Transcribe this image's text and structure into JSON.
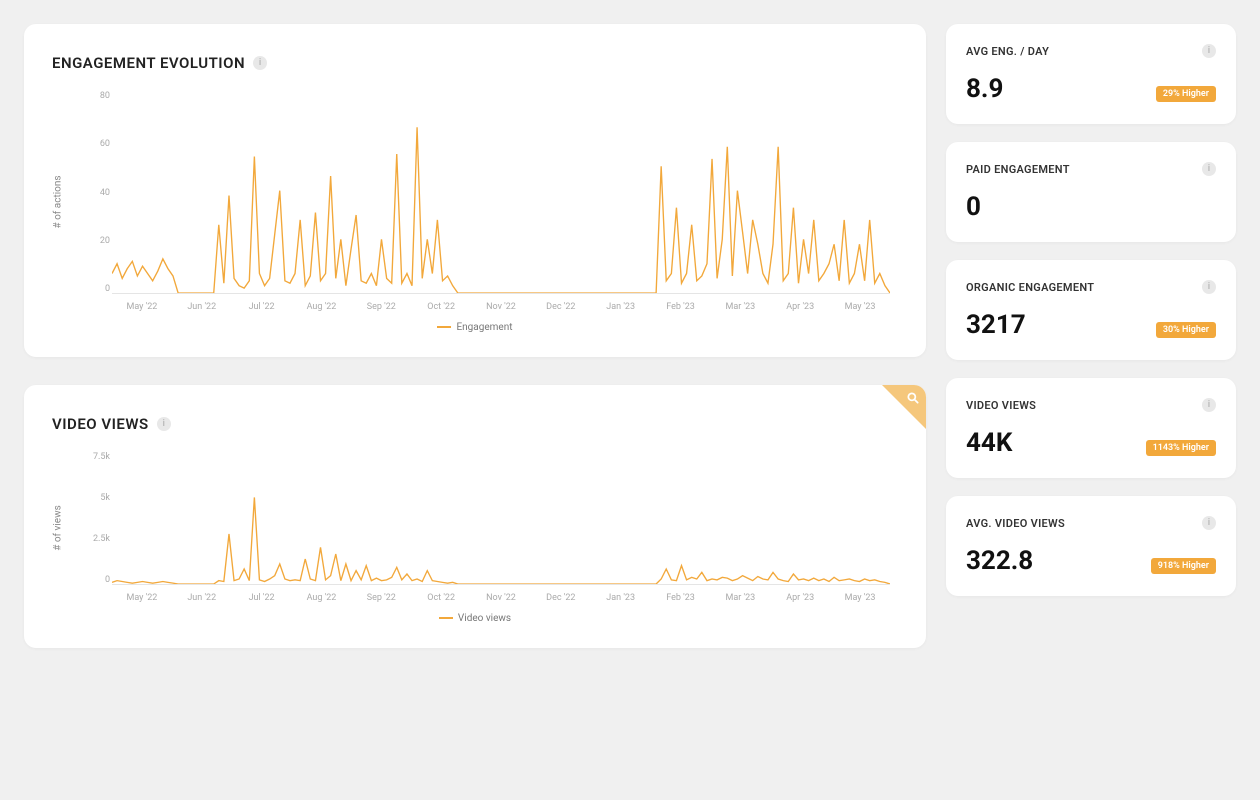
{
  "colors": {
    "accent": "#f2a83b"
  },
  "charts": {
    "engagement": {
      "title": "ENGAGEMENT EVOLUTION",
      "y_label": "# of actions",
      "legend": "Engagement"
    },
    "video": {
      "title": "VIDEO VIEWS",
      "y_label": "# of views",
      "legend": "Video views"
    },
    "x_ticks": [
      "May '22",
      "Jun '22",
      "Jul '22",
      "Aug '22",
      "Sep '22",
      "Oct '22",
      "Nov '22",
      "Dec '22",
      "Jan '23",
      "Feb '23",
      "Mar '23",
      "Apr '23",
      "May '23"
    ],
    "engagement_y_ticks": [
      "80",
      "60",
      "40",
      "20",
      "0"
    ],
    "video_y_ticks": [
      "7.5k",
      "5k",
      "2.5k",
      "0"
    ]
  },
  "stats": [
    {
      "label": "AVG ENG. / DAY",
      "value": "8.9",
      "badge": "29% Higher"
    },
    {
      "label": "PAID ENGAGEMENT",
      "value": "0",
      "badge": null
    },
    {
      "label": "ORGANIC ENGAGEMENT",
      "value": "3217",
      "badge": "30% Higher"
    },
    {
      "label": "VIDEO VIEWS",
      "value": "44K",
      "badge": "1143% Higher"
    },
    {
      "label": "AVG. VIDEO VIEWS",
      "value": "322.8",
      "badge": "918% Higher"
    }
  ],
  "chart_data": [
    {
      "type": "line",
      "title": "ENGAGEMENT EVOLUTION",
      "xlabel": "",
      "ylabel": "# of actions",
      "ylim": [
        0,
        80
      ],
      "x_tick_labels": [
        "May '22",
        "Jun '22",
        "Jul '22",
        "Aug '22",
        "Sep '22",
        "Oct '22",
        "Nov '22",
        "Dec '22",
        "Jan '23",
        "Feb '23",
        "Mar '23",
        "Apr '23",
        "May '23"
      ],
      "series": [
        {
          "name": "Engagement",
          "color": "#f2a83b",
          "values": [
            8,
            12,
            6,
            10,
            13,
            7,
            11,
            8,
            5,
            9,
            14,
            10,
            7,
            0,
            0,
            0,
            0,
            0,
            0,
            0,
            0,
            28,
            4,
            40,
            6,
            3,
            2,
            5,
            56,
            8,
            3,
            6,
            24,
            42,
            5,
            4,
            8,
            30,
            3,
            7,
            33,
            5,
            8,
            48,
            6,
            22,
            3,
            18,
            32,
            5,
            4,
            8,
            3,
            22,
            6,
            4,
            57,
            4,
            8,
            3,
            68,
            6,
            22,
            8,
            30,
            5,
            7,
            3,
            0,
            0,
            0,
            0,
            0,
            0,
            0,
            0,
            0,
            0,
            0,
            0,
            0,
            0,
            0,
            0,
            0,
            0,
            0,
            0,
            0,
            0,
            0,
            0,
            0,
            0,
            0,
            0,
            0,
            0,
            0,
            0,
            0,
            0,
            0,
            0,
            0,
            0,
            0,
            0,
            52,
            5,
            8,
            35,
            4,
            8,
            28,
            5,
            7,
            12,
            55,
            6,
            22,
            60,
            7,
            42,
            25,
            8,
            30,
            20,
            8,
            4,
            20,
            60,
            5,
            8,
            35,
            4,
            22,
            8,
            30,
            5,
            8,
            12,
            20,
            5,
            30,
            4,
            8,
            20,
            5,
            30,
            4,
            8,
            3,
            0
          ]
        }
      ]
    },
    {
      "type": "line",
      "title": "VIDEO VIEWS",
      "xlabel": "",
      "ylabel": "# of views",
      "ylim": [
        0,
        7500
      ],
      "x_tick_labels": [
        "May '22",
        "Jun '22",
        "Jul '22",
        "Aug '22",
        "Sep '22",
        "Oct '22",
        "Nov '22",
        "Dec '22",
        "Jan '23",
        "Feb '23",
        "Mar '23",
        "Apr '23",
        "May '23"
      ],
      "series": [
        {
          "name": "Video views",
          "color": "#f2a83b",
          "values": [
            100,
            200,
            150,
            100,
            50,
            100,
            150,
            100,
            50,
            100,
            150,
            100,
            50,
            0,
            0,
            0,
            0,
            0,
            0,
            0,
            0,
            200,
            150,
            3000,
            200,
            300,
            900,
            200,
            5200,
            250,
            150,
            300,
            500,
            1200,
            300,
            200,
            250,
            200,
            1500,
            300,
            200,
            2200,
            250,
            500,
            1800,
            200,
            1200,
            200,
            800,
            250,
            1100,
            200,
            350,
            200,
            250,
            400,
            1000,
            250,
            600,
            200,
            300,
            150,
            800,
            200,
            150,
            100,
            50,
            100,
            0,
            0,
            0,
            0,
            0,
            0,
            0,
            0,
            0,
            0,
            0,
            0,
            0,
            0,
            0,
            0,
            0,
            0,
            0,
            0,
            0,
            0,
            0,
            0,
            0,
            0,
            0,
            0,
            0,
            0,
            0,
            0,
            0,
            0,
            0,
            0,
            0,
            0,
            0,
            0,
            300,
            900,
            250,
            200,
            1100,
            250,
            400,
            300,
            700,
            200,
            300,
            250,
            400,
            350,
            200,
            300,
            500,
            350,
            200,
            450,
            300,
            250,
            700,
            300,
            200,
            150,
            600,
            250,
            300,
            200,
            350,
            200,
            300,
            150,
            400,
            200,
            250,
            300,
            200,
            150,
            300,
            200,
            250,
            150,
            100,
            0
          ]
        }
      ]
    }
  ]
}
